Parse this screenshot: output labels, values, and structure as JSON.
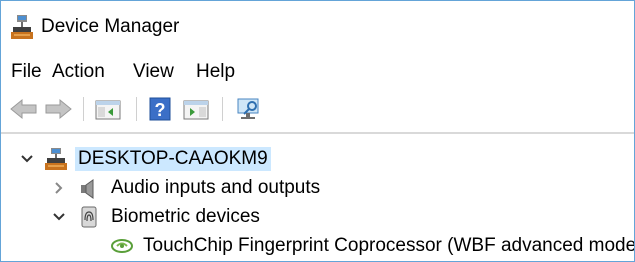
{
  "window": {
    "title": "Device Manager"
  },
  "menu": {
    "items": [
      "File",
      "Action",
      "View",
      "Help"
    ]
  },
  "toolbar": {
    "buttons": [
      "back-icon",
      "forward-icon",
      "show-hide-console-tree-icon",
      "help-icon",
      "show-hide-action-pane-icon",
      "scan-hardware-icon"
    ]
  },
  "tree": {
    "root": {
      "label": "DESKTOP-CAAOKM9",
      "expanded": true
    },
    "categories": [
      {
        "label": "Audio inputs and outputs",
        "expanded": false
      },
      {
        "label": "Biometric devices",
        "expanded": true,
        "children": [
          {
            "label": "TouchChip Fingerprint Coprocessor (WBF advanced mode)"
          }
        ]
      }
    ]
  },
  "colors": {
    "accent_border": "#64a4d8",
    "selection": "#cce8ff"
  }
}
